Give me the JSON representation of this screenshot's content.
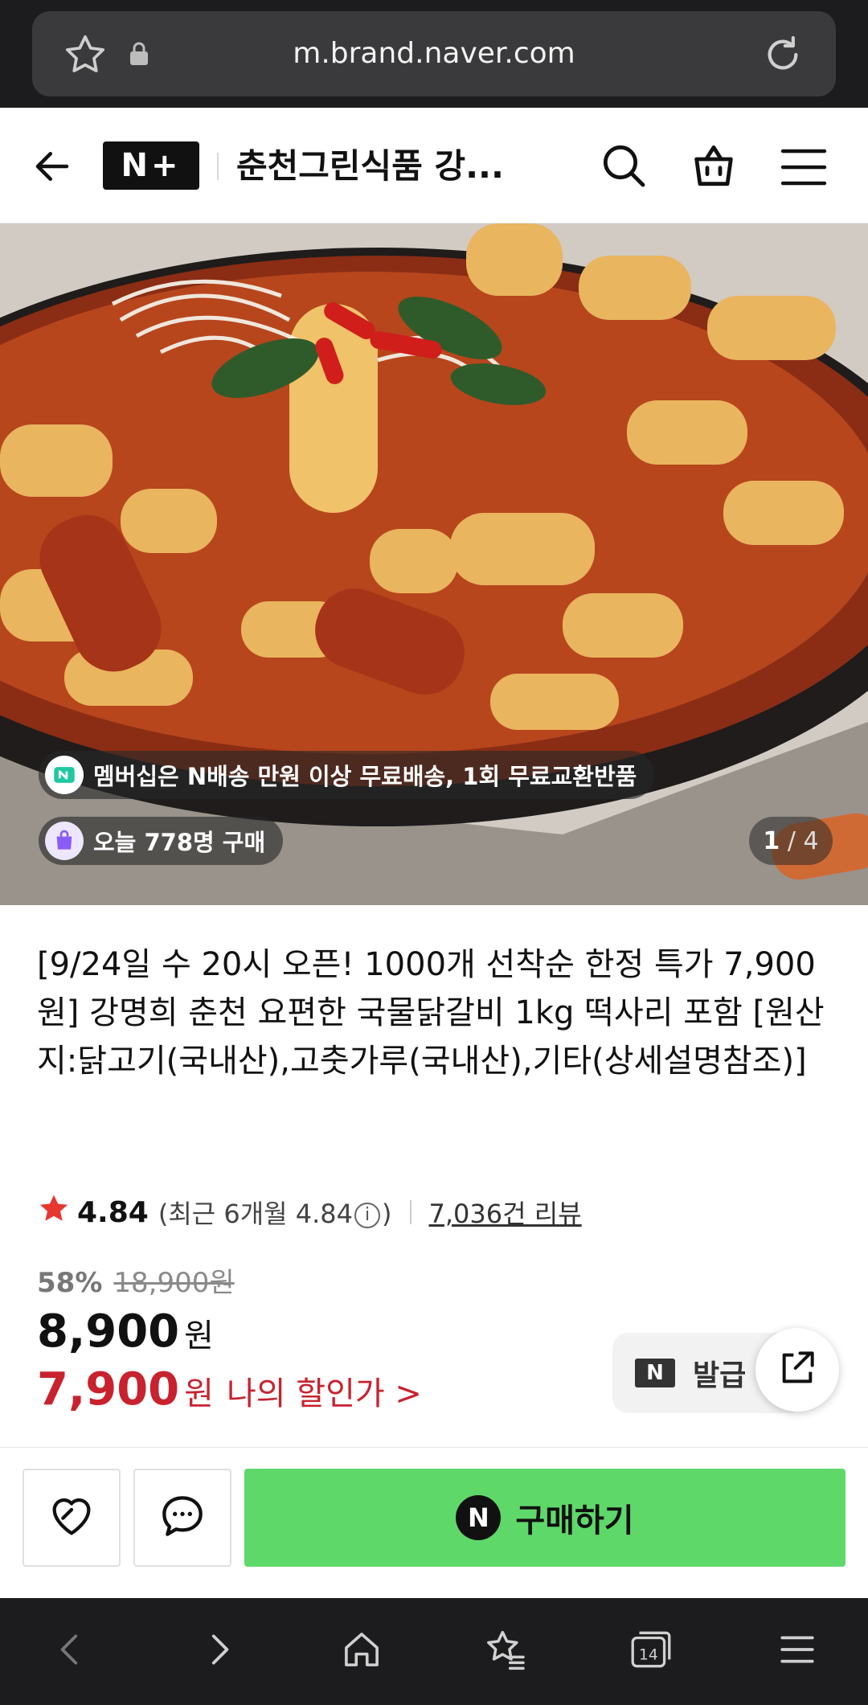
{
  "browser": {
    "url": "m.brand.naver.com",
    "tab_count": "14"
  },
  "header": {
    "logo": "N+",
    "store_name": "춘천그린식품 강..."
  },
  "hero": {
    "shipping_chip": "멤버십은 N배송 만원 이상 무료배송, 1회 무료교환반품",
    "today_chip": "오늘 778명 구매",
    "counter_current": "1",
    "counter_total": "/ 4"
  },
  "product": {
    "title": "[9/24일 수 20시 오픈! 1000개 선착순 한정 특가 7,900원] 강명희 춘천 요편한 국물닭갈비 1kg 떡사리 포함 [원산지:닭고기(국내산),고춧가루(국내산),기타(상세설명참조)]",
    "rating": "4.84",
    "recent_prefix": "(최근 6개월 4.84",
    "recent_suffix": ")",
    "reviews": "7,036건 리뷰",
    "discount_pct": "58%",
    "original_price": "18,900원",
    "price": "8,900",
    "price_unit": "원",
    "my_price": "7,900",
    "my_price_unit": "원",
    "my_price_label": "나의 할인가 >",
    "coupon_badge": "N",
    "coupon_label": "발급"
  },
  "actions": {
    "buy_label": "구매하기",
    "buy_badge": "N"
  },
  "colors": {
    "buy_green": "#5fd86a",
    "sale_red": "#c8222e",
    "star": "#e5372f"
  }
}
